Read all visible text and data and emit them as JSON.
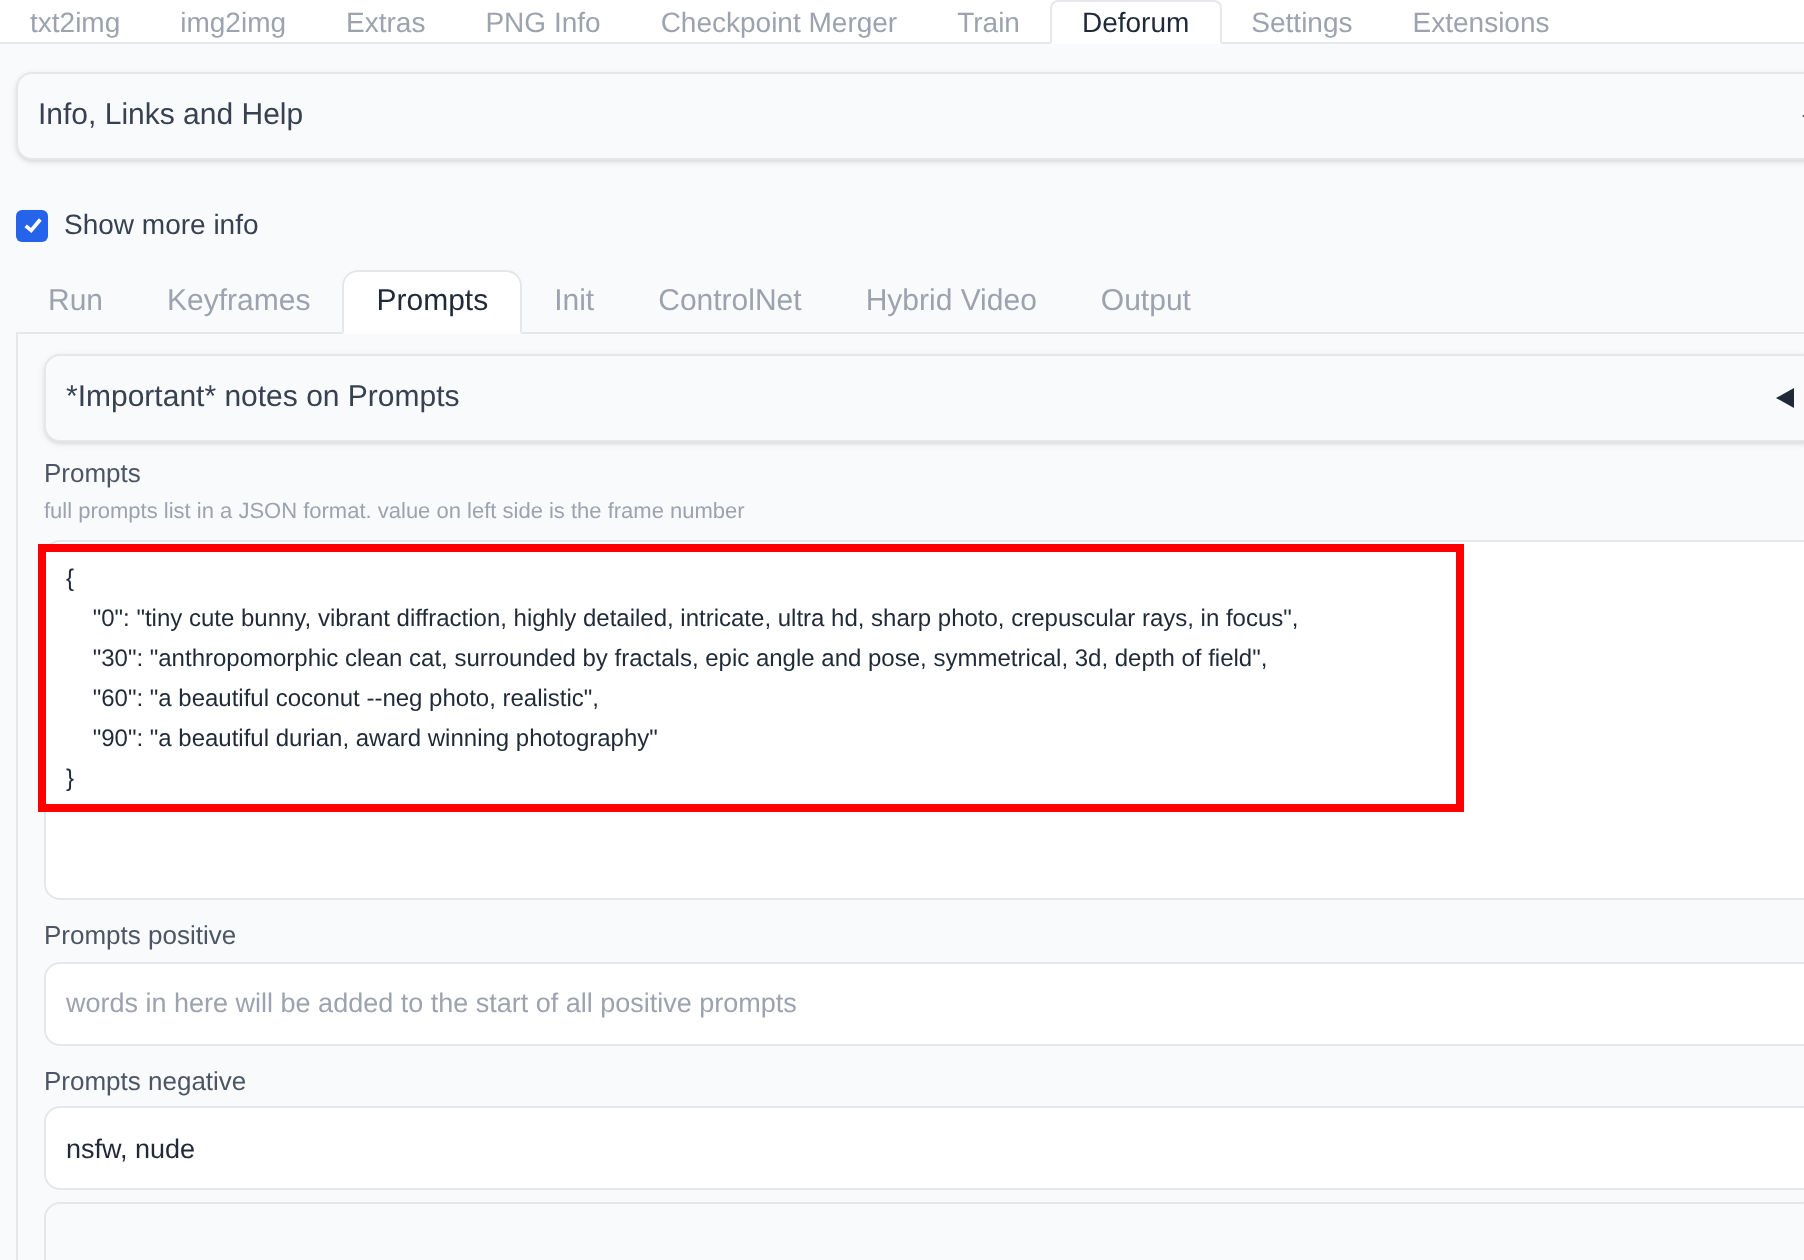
{
  "top_tabs": [
    {
      "label": "txt2img",
      "selected": false
    },
    {
      "label": "img2img",
      "selected": false
    },
    {
      "label": "Extras",
      "selected": false
    },
    {
      "label": "PNG Info",
      "selected": false
    },
    {
      "label": "Checkpoint Merger",
      "selected": false
    },
    {
      "label": "Train",
      "selected": false
    },
    {
      "label": "Deforum",
      "selected": true
    },
    {
      "label": "Settings",
      "selected": false
    },
    {
      "label": "Extensions",
      "selected": false
    }
  ],
  "info_accordion": {
    "title": "Info, Links and Help",
    "expanded": false
  },
  "show_more_info": {
    "label": "Show more info",
    "checked": true
  },
  "sub_tabs": [
    {
      "label": "Run",
      "selected": false
    },
    {
      "label": "Keyframes",
      "selected": false
    },
    {
      "label": "Prompts",
      "selected": true
    },
    {
      "label": "Init",
      "selected": false
    },
    {
      "label": "ControlNet",
      "selected": false
    },
    {
      "label": "Hybrid Video",
      "selected": false
    },
    {
      "label": "Output",
      "selected": false
    }
  ],
  "notes_accordion": {
    "title": "*Important* notes on Prompts",
    "expanded": false
  },
  "prompts": {
    "label": "Prompts",
    "hint": "full prompts list in a JSON format. value on left side is the frame number",
    "highlighted": true,
    "lines": [
      "{",
      "    \"0\": \"tiny cute bunny, vibrant diffraction, highly detailed, intricate, ultra hd, sharp photo, crepuscular rays, in focus\",",
      "    \"30\": \"anthropomorphic clean cat, surrounded by fractals, epic angle and pose, symmetrical, 3d, depth of field\",",
      "    \"60\": \"a beautiful coconut --neg photo, realistic\",",
      "    \"90\": \"a beautiful durian, award winning photography\"",
      "}"
    ]
  },
  "prompts_positive": {
    "label": "Prompts positive",
    "placeholder": "words in here will be added to the start of all positive prompts"
  },
  "prompts_negative": {
    "label": "Prompts negative",
    "value": "nsfw, nude"
  }
}
